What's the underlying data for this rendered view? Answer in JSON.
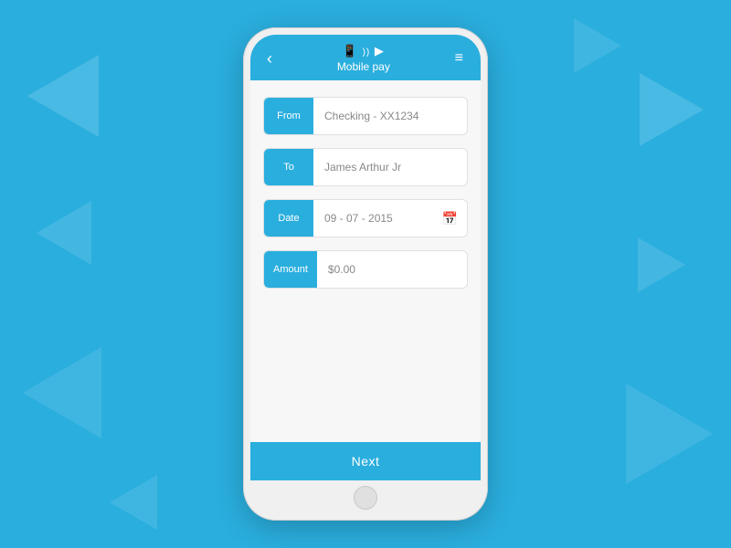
{
  "background": {
    "color": "#2aaede"
  },
  "header": {
    "back_icon": "‹",
    "menu_icon": "≡",
    "pay_icon": "📱",
    "title": "Mobile pay"
  },
  "form": {
    "from_label": "From",
    "from_value": "Checking - XX1234",
    "to_label": "To",
    "to_value": "James Arthur Jr",
    "date_label": "Date",
    "date_value": "09 - 07 - 2015",
    "date_icon": "📅",
    "amount_label": "Amount",
    "amount_value": "$0.00"
  },
  "footer": {
    "next_label": "Next"
  }
}
